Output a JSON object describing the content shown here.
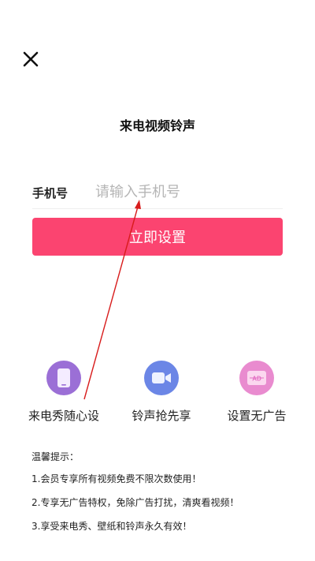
{
  "page": {
    "title": "来电视频铃声"
  },
  "form": {
    "phone_label": "手机号",
    "phone_placeholder": "请输入手机号",
    "phone_value": "",
    "submit_label": "立即设置"
  },
  "features": [
    {
      "label": "来电秀随心设",
      "icon": "phone-icon",
      "color": "#9b6fd6"
    },
    {
      "label": "铃声抢先享",
      "icon": "video-camera-icon",
      "color": "#6b86e6"
    },
    {
      "label": "设置无广告",
      "icon": "ad-icon",
      "color": "#e98bcf"
    }
  ],
  "tips": {
    "title": "温馨提示：",
    "items": [
      "1.会员专享所有视频免费不限次数使用！",
      "2.专享无广告特权，免除广告打扰，清爽看视频！",
      "3.享受来电秀、壁纸和铃声永久有效！"
    ]
  },
  "colors": {
    "accent": "#fb4470",
    "annotation_arrow": "#d81c1c"
  }
}
